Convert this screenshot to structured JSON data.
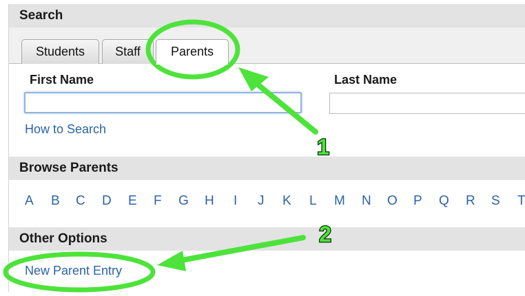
{
  "search": {
    "title": "Search",
    "tabs": [
      {
        "label": "Students",
        "active": false
      },
      {
        "label": "Staff",
        "active": false
      },
      {
        "label": "Parents",
        "active": true
      }
    ],
    "first_name_label": "First Name",
    "first_name_value": "",
    "last_name_label": "Last Name",
    "last_name_value": "",
    "how_to_search": "How to Search"
  },
  "browse": {
    "title": "Browse Parents",
    "letters": [
      "A",
      "B",
      "C",
      "D",
      "E",
      "F",
      "G",
      "H",
      "I",
      "J",
      "K",
      "L",
      "M",
      "N",
      "O",
      "P",
      "Q",
      "R",
      "S",
      "T"
    ]
  },
  "other_options": {
    "title": "Other Options",
    "new_parent_entry": "New Parent Entry"
  },
  "annotations": {
    "color": "#4de33a",
    "callout_1": "1",
    "callout_2": "2"
  }
}
